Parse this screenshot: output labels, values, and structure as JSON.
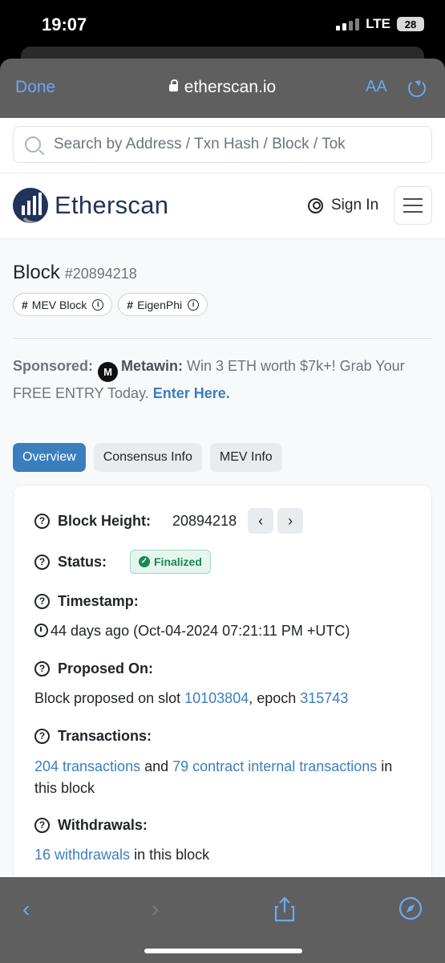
{
  "status_bar": {
    "time": "19:07",
    "network": "LTE",
    "battery": "28"
  },
  "safari": {
    "done_label": "Done",
    "url": "etherscan.io",
    "text_size_label": "AA"
  },
  "search": {
    "placeholder": "Search by Address / Txn Hash / Block / Tok"
  },
  "navbar": {
    "logo_text": "Etherscan",
    "sign_in_label": "Sign In"
  },
  "block": {
    "title": "Block",
    "number": "#20894218",
    "tags": [
      {
        "label": "MEV Block"
      },
      {
        "label": "EigenPhi"
      }
    ]
  },
  "sponsored": {
    "label": "Sponsored:",
    "brand": "Metawin:",
    "text": " Win 3 ETH worth $7k+! Grab Your FREE ENTRY Today. ",
    "cta": "Enter Here."
  },
  "tabs": [
    {
      "label": "Overview",
      "active": true
    },
    {
      "label": "Consensus Info"
    },
    {
      "label": "MEV Info"
    }
  ],
  "overview": {
    "block_height": {
      "label": "Block Height:",
      "value": "20894218"
    },
    "status": {
      "label": "Status:",
      "value": "Finalized"
    },
    "timestamp": {
      "label": "Timestamp:",
      "value": "44 days ago (Oct-04-2024 07:21:11 PM +UTC)"
    },
    "proposed_on": {
      "label": "Proposed On:",
      "prefix": "Block proposed on slot ",
      "slot": "10103804",
      "middle": ", epoch ",
      "epoch": "315743"
    },
    "transactions": {
      "label": "Transactions:",
      "tx_link": "204 transactions",
      "middle": " and ",
      "internal_link": "79 contract internal transactions",
      "suffix": " in this block"
    },
    "withdrawals": {
      "label": "Withdrawals:",
      "link": "16 withdrawals",
      "suffix": " in this block"
    }
  },
  "colors": {
    "accent": "#3a7fbd",
    "brand": "#21325b",
    "safari_blue": "#6aa8f5",
    "success": "#198754"
  }
}
